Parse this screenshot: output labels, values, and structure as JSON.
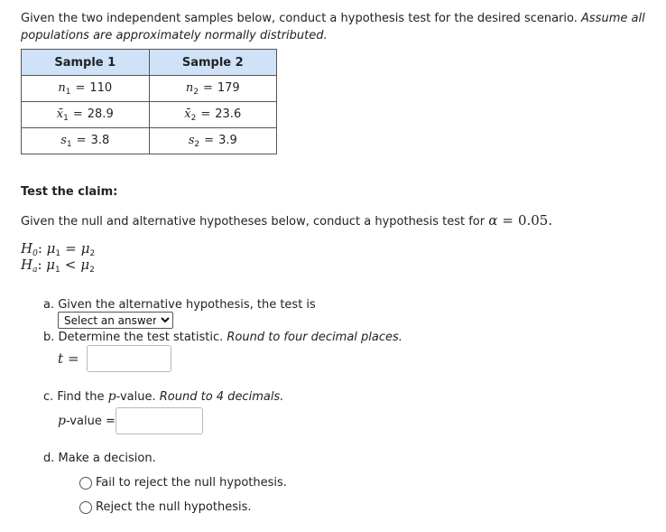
{
  "intro": {
    "text": "Given the two independent samples below, conduct a hypothesis test for the desired scenario. ",
    "italic": "Assume all populations are approximately normally distributed."
  },
  "table": {
    "headers": [
      "Sample 1",
      "Sample 2"
    ],
    "rows": [
      {
        "sym1": "n",
        "sub1": "1",
        "val1": "110",
        "sym2": "n",
        "sub2": "2",
        "val2": "179"
      },
      {
        "sym1": "x̄",
        "sub1": "1",
        "val1": "28.9",
        "sym2": "x̄",
        "sub2": "2",
        "val2": "23.6"
      },
      {
        "sym1": "s",
        "sub1": "1",
        "val1": "3.8",
        "sym2": "s",
        "sub2": "2",
        "val2": "3.9"
      }
    ]
  },
  "claim_label": "Test the claim:",
  "given": {
    "text": "Given the null and alternative hypotheses below, conduct a hypothesis test for ",
    "alpha_symbol": "α",
    "alpha_value": "0.05."
  },
  "hypotheses": {
    "h0": {
      "label": "H",
      "sub": "0",
      "lhs": "μ",
      "lhs_sub": "1",
      "op": "=",
      "rhs": "μ",
      "rhs_sub": "2"
    },
    "ha": {
      "label": "H",
      "sub": "a",
      "lhs": "μ",
      "lhs_sub": "1",
      "op": "<",
      "rhs": "μ",
      "rhs_sub": "2"
    }
  },
  "questions": {
    "a": {
      "text": "a. Given the alternative hypothesis, the test is",
      "select_value": "Select an answer"
    },
    "b": {
      "text": "b. Determine the test statistic. ",
      "italic": "Round to four decimal places.",
      "var": "t",
      "eq": "=",
      "input_value": ""
    },
    "c": {
      "text": "c. Find the ",
      "p": "p",
      "text2": "-value. ",
      "italic": "Round to 4 decimals.",
      "label_p": "p",
      "label": "-value =",
      "input_value": ""
    },
    "d": {
      "text": "d. Make a decision.",
      "options": [
        "Fail to reject the null hypothesis.",
        "Reject the null hypothesis."
      ]
    }
  }
}
